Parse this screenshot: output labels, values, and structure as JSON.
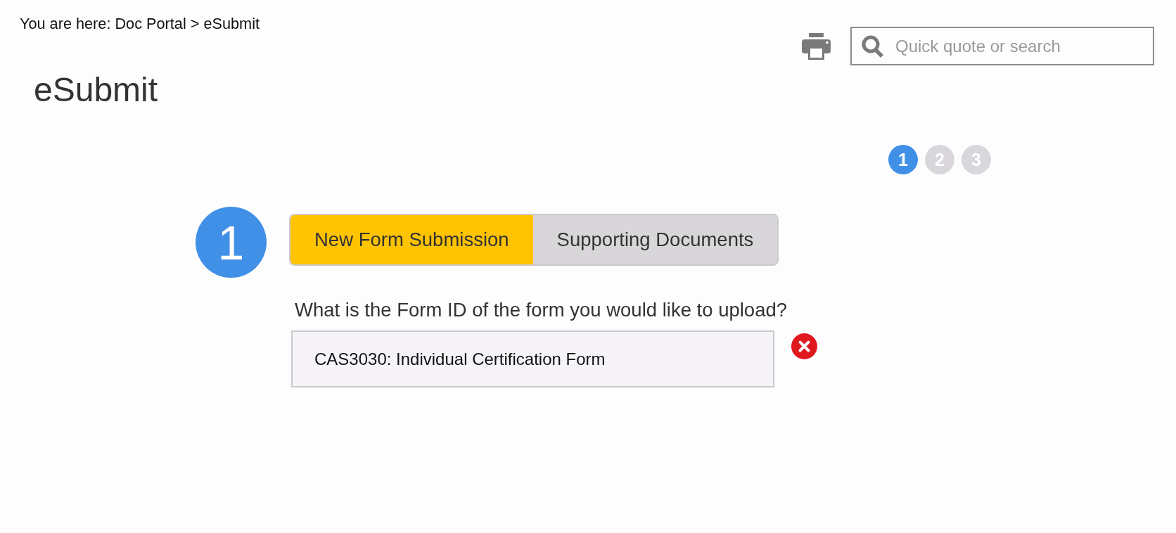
{
  "breadcrumb": "You are here: Doc Portal > eSubmit",
  "toolbar": {
    "search": {
      "placeholder": "Quick quote or search"
    }
  },
  "page_title": "eSubmit",
  "steps": [
    {
      "label": "1",
      "selected": true
    },
    {
      "label": "2",
      "selected": false
    },
    {
      "label": "3",
      "selected": false
    }
  ],
  "section": {
    "number": "1",
    "tabs": [
      {
        "label": "New Form Submission",
        "selected": true
      },
      {
        "label": "Supporting Documents",
        "selected": false
      }
    ],
    "question": "What is the Form ID of the form you would like to upload?",
    "form_id_field": {
      "value": "CAS3030: Individual Certification Form"
    }
  }
}
